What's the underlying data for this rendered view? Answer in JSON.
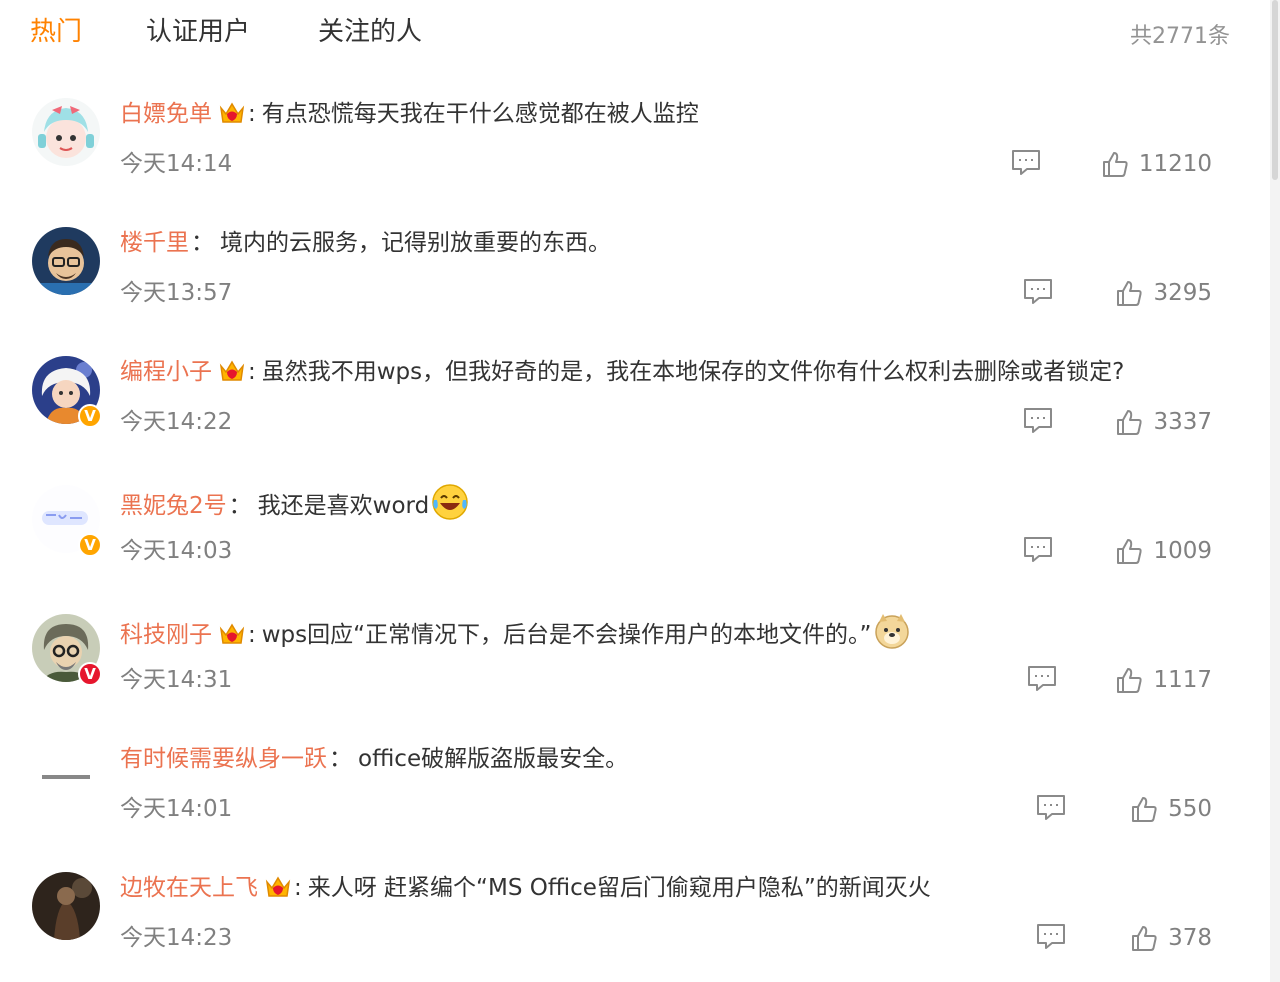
{
  "tabs": [
    {
      "label": "热门",
      "active": true
    },
    {
      "label": "认证用户",
      "active": false
    },
    {
      "label": "关注的人",
      "active": false
    }
  ],
  "total_count": "共2771条",
  "colors": {
    "accent": "#ff8200",
    "username": "#eb7350",
    "meta": "#808080"
  },
  "comments": [
    {
      "user": "白嫖免单",
      "has_crown": true,
      "separator": ":",
      "text": "有点恐慌每天我在干什么感觉都在被人监控",
      "time": "今天14:14",
      "likes": "11210",
      "badge": "",
      "emoji": ""
    },
    {
      "user": "楼千里",
      "has_crown": false,
      "separator": "：",
      "text": "境内的云服务，记得别放重要的东西。",
      "time": "今天13:57",
      "likes": "3295",
      "badge": "",
      "emoji": ""
    },
    {
      "user": "编程小子",
      "has_crown": true,
      "separator": ":",
      "text": "虽然我不用wps，但我好奇的是，我在本地保存的文件你有什么权利去删除或者锁定?",
      "time": "今天14:22",
      "likes": "3337",
      "badge": "gold",
      "emoji": ""
    },
    {
      "user": "黑妮兔2号",
      "has_crown": false,
      "separator": "：",
      "text": "我还是喜欢word",
      "time": "今天14:03",
      "likes": "1009",
      "badge": "gold",
      "emoji": "laugh-cry-emoji"
    },
    {
      "user": "科技刚子",
      "has_crown": true,
      "separator": ":",
      "text": "wps回应“正常情况下，后台是不会操作用户的本地文件的。”",
      "time": "今天14:31",
      "likes": "1117",
      "badge": "red",
      "emoji": "doge-emoji"
    },
    {
      "user": "有时候需要纵身一跃",
      "has_crown": false,
      "separator": "：",
      "text": "office破解版盗版最安全。",
      "time": "今天14:01",
      "likes": "550",
      "badge": "",
      "emoji": ""
    },
    {
      "user": "边牧在天上飞",
      "has_crown": true,
      "separator": ":",
      "text": "来人呀 赶紧编个“MS Office留后门偷窥用户隐私”的新闻灭火",
      "time": "今天14:23",
      "likes": "378",
      "badge": "",
      "emoji": ""
    }
  ]
}
